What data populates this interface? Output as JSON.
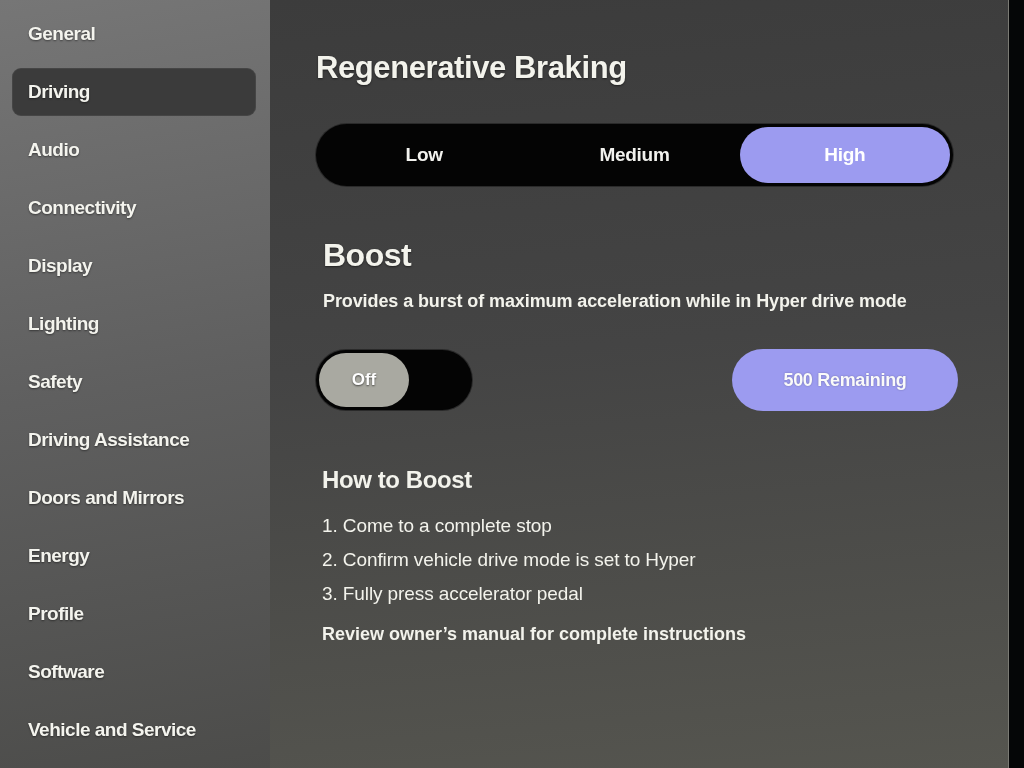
{
  "sidebar": {
    "items": [
      {
        "label": "General",
        "selected": false
      },
      {
        "label": "Driving",
        "selected": true
      },
      {
        "label": "Audio",
        "selected": false
      },
      {
        "label": "Connectivity",
        "selected": false
      },
      {
        "label": "Display",
        "selected": false
      },
      {
        "label": "Lighting",
        "selected": false
      },
      {
        "label": "Safety",
        "selected": false
      },
      {
        "label": "Driving Assistance",
        "selected": false
      },
      {
        "label": "Doors and Mirrors",
        "selected": false
      },
      {
        "label": "Energy",
        "selected": false
      },
      {
        "label": "Profile",
        "selected": false
      },
      {
        "label": "Software",
        "selected": false
      },
      {
        "label": "Vehicle and Service",
        "selected": false
      }
    ]
  },
  "regenerative_braking": {
    "title": "Regenerative Braking",
    "options": [
      {
        "label": "Low",
        "selected": false
      },
      {
        "label": "Medium",
        "selected": false
      },
      {
        "label": "High",
        "selected": true
      }
    ]
  },
  "boost": {
    "title": "Boost",
    "description": "Provides a burst of maximum acceleration while in Hyper drive mode",
    "toggle": {
      "label": "Off",
      "on": false
    },
    "remaining": "500 Remaining"
  },
  "how_to_boost": {
    "title": "How to Boost",
    "steps": [
      "1. Come to a complete stop",
      "2. Confirm vehicle drive mode is set to Hyper",
      "3. Fully press accelerator pedal"
    ],
    "note": "Review owner’s manual for complete instructions"
  }
}
